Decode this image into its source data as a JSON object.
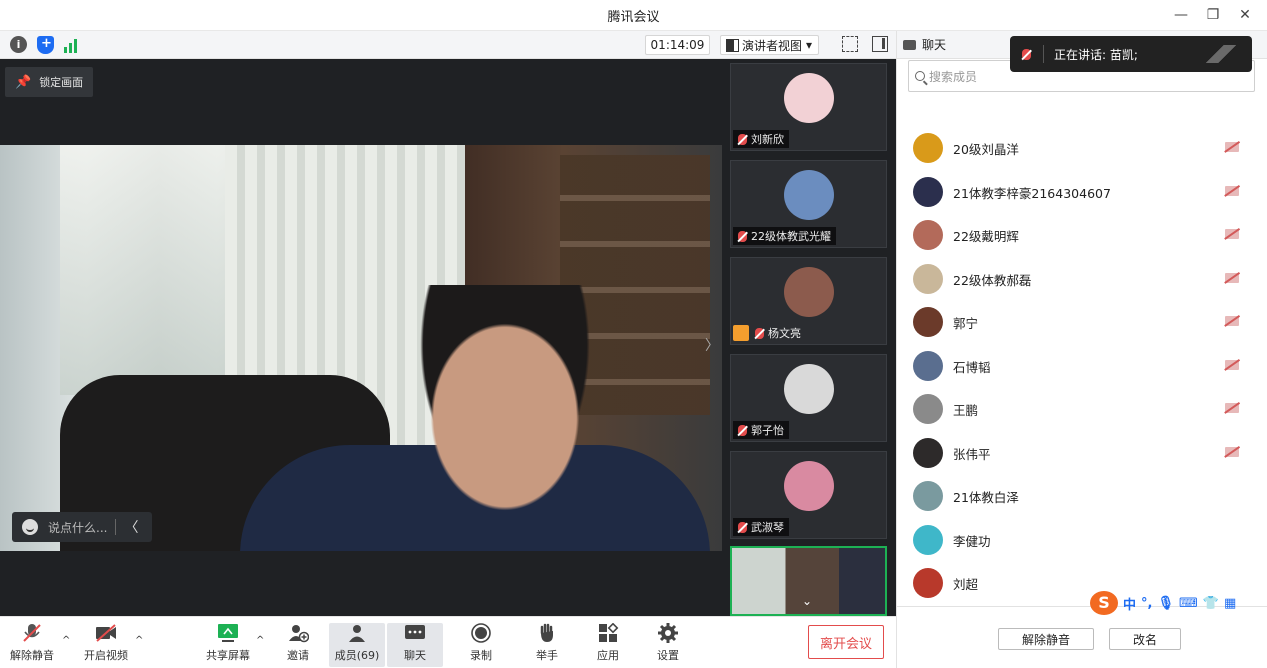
{
  "window": {
    "title": "腾讯会议",
    "minimize": "—",
    "restore": "❐",
    "close": "✕"
  },
  "infobar": {
    "timer": "01:14:09",
    "view_label": "演讲者视图",
    "view_caret": "▾"
  },
  "stage": {
    "lock_label": "锁定画面",
    "chat_placeholder": "说点什么...",
    "collapse_arrow": "〉",
    "chat_collapse": "〈"
  },
  "tiles": [
    {
      "name": "刘新欣",
      "avatar_color": "#f2d1d5"
    },
    {
      "name": "22级体教武光耀",
      "avatar_color": "#6b8dbf"
    },
    {
      "name": "杨文亮",
      "avatar_color": "#8c5b4d",
      "badge": true
    },
    {
      "name": "郭子怡",
      "avatar_color": "#d9d9d9"
    },
    {
      "name": "武淑琴",
      "avatar_color": "#d98aa1"
    }
  ],
  "toolbar": {
    "unmute": "解除静音",
    "video": "开启视频",
    "share": "共享屏幕",
    "invite": "邀请",
    "members": "成员(69)",
    "chat": "聊天",
    "record": "录制",
    "raise": "举手",
    "apps": "应用",
    "settings": "设置",
    "leave": "离开会议",
    "caret": "^"
  },
  "panel": {
    "tab_label": "聊天",
    "search_placeholder": "搜索成员",
    "members": [
      {
        "name": "20级刘晶洋",
        "color": "#d99a1a"
      },
      {
        "name": "21体教李梓豪2164304607",
        "color": "#2b2f4d"
      },
      {
        "name": "22级戴明辉",
        "color": "#b36a5a"
      },
      {
        "name": "22级体教郝磊",
        "color": "#c9b79a"
      },
      {
        "name": "郭宁",
        "color": "#6b3a2a"
      },
      {
        "name": "石博韬",
        "color": "#5a6e8f"
      },
      {
        "name": "王鹏",
        "color": "#8a8a8a"
      },
      {
        "name": "张伟平",
        "color": "#2d2a2a"
      },
      {
        "name": "21体教白泽",
        "color": "#7a9a9f"
      },
      {
        "name": "李健功",
        "color": "#3fb7c9"
      },
      {
        "name": "刘超",
        "color": "#b8392b"
      }
    ],
    "unmute_btn": "解除静音",
    "rename_btn": "改名",
    "ime": {
      "logo": "S",
      "lang": "中",
      "punct": "°,",
      "mic": "🎙",
      "kbd": "⌨",
      "shirt": "👕",
      "grid": "▦"
    }
  },
  "toast": {
    "text": "正在讲话: 苗凯;"
  }
}
